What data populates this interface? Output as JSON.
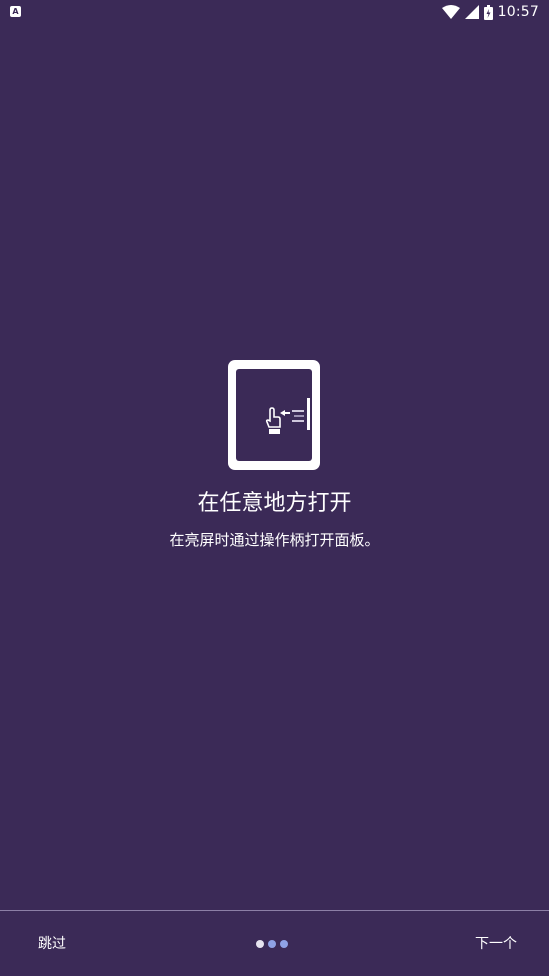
{
  "status_bar": {
    "notification_icon": "a-icon",
    "notification_glyph": "A",
    "icons": [
      "wifi-icon",
      "signal-icon",
      "battery-icon"
    ],
    "time": "10:57"
  },
  "onboarding": {
    "illustration_icon": "tablet-swipe-handle-icon",
    "title": "在任意地方打开",
    "subtitle": "在亮屏时通过操作柄打开面板。"
  },
  "footer": {
    "skip_label": "跳过",
    "next_label": "下一个",
    "page_indicator": {
      "total": 3,
      "current": 1
    }
  },
  "colors": {
    "background": "#3b2a57",
    "divider": "#8c7fa6",
    "dot_active": "#e6e3ef",
    "dot_inactive": "#8fa2e6"
  }
}
